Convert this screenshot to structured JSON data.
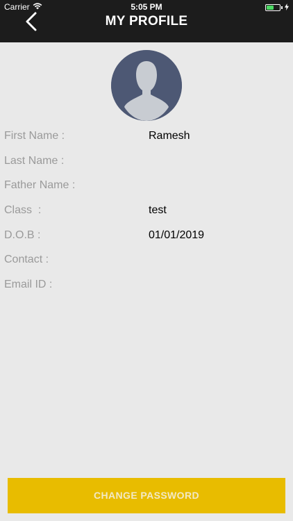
{
  "status_bar": {
    "carrier": "Carrier",
    "time": "5:05 PM",
    "wifi_icon": "wifi-icon",
    "battery_icon": "battery-icon",
    "charging_icon": "charging-bolt-icon"
  },
  "header": {
    "title": "MY PROFILE",
    "back_icon": "chevron-left-icon",
    "background_color": "#1c1c1c"
  },
  "avatar": {
    "icon": "user-silhouette-icon",
    "background_color": "#4d5874"
  },
  "profile": {
    "fields": [
      {
        "label": "First Name :",
        "value": "Ramesh"
      },
      {
        "label": "Last Name :",
        "value": ""
      },
      {
        "label": "Father Name :",
        "value": ""
      },
      {
        "label": "Class  :",
        "value": "test"
      },
      {
        "label": "D.O.B :",
        "value": "01/01/2019"
      },
      {
        "label": "Contact :",
        "value": ""
      },
      {
        "label": "Email ID :",
        "value": ""
      }
    ]
  },
  "footer": {
    "change_password_label": "CHANGE PASSWORD",
    "button_color": "#e8bc00"
  }
}
